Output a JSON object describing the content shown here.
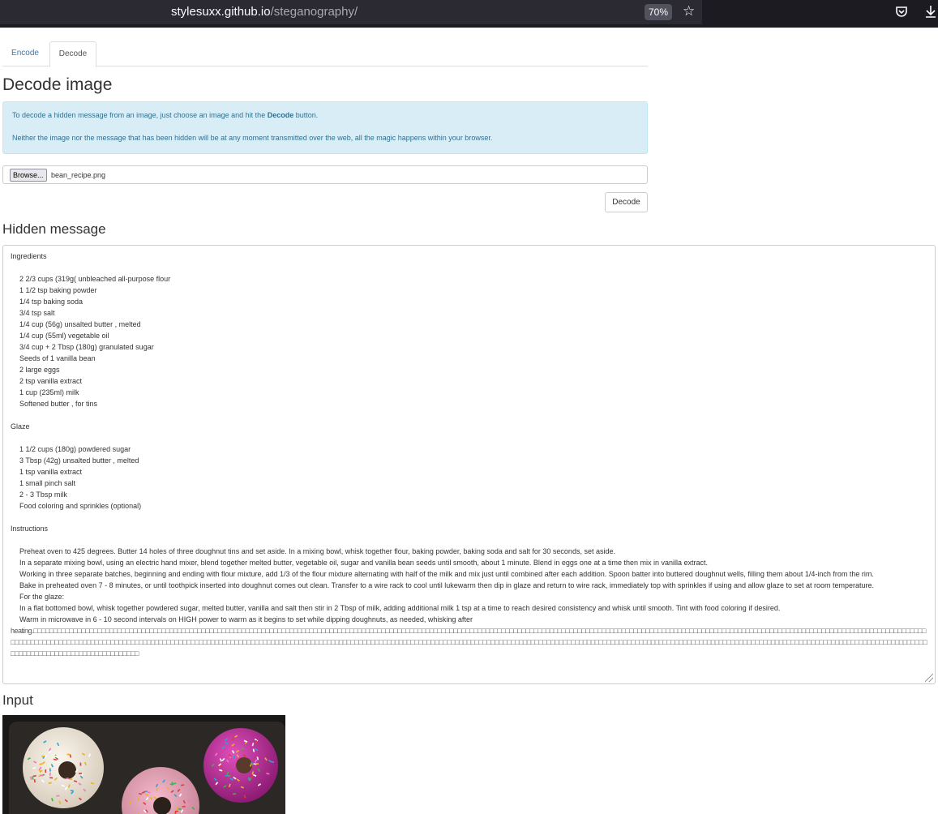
{
  "browser": {
    "url_host": "stylesuxx.github.io",
    "url_path": "/steganography/",
    "zoom": "70%",
    "bookmark_icon": "star-icon",
    "pocket_icon": "pocket-icon",
    "download_icon": "download-icon"
  },
  "tabs": {
    "encode": "Encode",
    "decode": "Decode",
    "active": "Decode"
  },
  "page_title": "Decode image",
  "alert": {
    "line1_before": "To decode a hidden message from an image, just choose an image and hit the ",
    "line1_bold": "Decode",
    "line1_after": " button.",
    "line2": "Neither the image nor the message that has been hidden will be at any moment transmitted over the web, all the magic happens within your browser."
  },
  "file_input": {
    "button": "Browse...",
    "filename": "bean_recipe.png"
  },
  "decode_button": "Decode",
  "hidden_heading": "Hidden message",
  "message": {
    "ingredients_title": "Ingredients",
    "ingredients": [
      "2 2/3 cups (319g( unbleached all-purpose flour",
      "1 1/2 tsp baking powder",
      "1/4 tsp baking soda",
      "3/4 tsp salt",
      "1/4 cup (56g) unsalted butter , melted",
      "1/4 cup (55ml) vegetable oil",
      "3/4 cup + 2 Tbsp (180g) granulated sugar",
      "Seeds of 1 vanilla bean",
      "2 large eggs",
      "2 tsp vanilla extract",
      "1 cup (235ml) milk",
      "Softened butter , for tins"
    ],
    "glaze_title": "Glaze",
    "glaze": [
      "1 1/2 cups (180g) powdered sugar",
      "3 Tbsp (42g) unsalted butter , melted",
      "1 tsp vanilla extract",
      "1 small pinch salt",
      "2 - 3 Tbsp milk",
      "Food coloring and sprinkles (optional)"
    ],
    "instructions_title": "Instructions",
    "instructions": [
      "Preheat oven to 425 degrees. Butter 14 holes of three doughnut tins and set aside. In a mixing bowl, whisk together flour, baking powder, baking soda and salt for 30 seconds, set aside.",
      "In a separate mixing bowl, using an electric hand mixer, blend together melted butter, vegetable oil, sugar and vanilla bean seeds until smooth, about 1 minute. Blend in eggs one at a time then mix in vanilla extract.",
      "Working in three separate batches, beginning and ending with flour mixture, add 1/3 of the flour mixture alternating with half of the milk and mix just until combined after each addition. Spoon batter into buttered doughnut wells, filling them about 1/4-inch from the rim.",
      "Bake in preheated oven 7 - 8 minutes, or until toothpick inserted into doughnut comes out clean. Transfer to a wire rack to cool until lukewarm then dip in glaze and return to wire rack, immediately top with sprinkles if using and allow glaze to set at room temperature.",
      "For the glaze:",
      "In a flat bottomed bowl, whisk together powdered sugar, melted butter, vanilla and salt then stir in 2 Tbsp of milk, adding additional milk 1 tsp at a time to reach desired consistency and whisk until smooth. Tint with food coloring if desired.",
      "Warm in microwave in 6 - 10 second intervals on HIGH power to warm as it begins to set while dipping doughnuts, as needed, whisking after"
    ],
    "trailing_word": "heating.",
    "trailing_glyphs": "□□□□□□□□□□□□□□□□□□□□□□□□□□□□□□□□□□□□□□□□□□□□□□□□□□□□□□□□□□□□□□□□□□□□□□□□□□□□□□□□□□□□□□□□□□□□□□□□□□□□□□□□□□□□□□□□□□□□□□□□□□□□□□□□□□□□□□□□□□□□□□□□□□□□□□□□□□□□□□□□□□□□□□□□□□□□□□□□□□□□□□□□□□□□□□□□□□□□□□□□□□□□□□□□□□□□□□□□□□□□□□□□□□□□□□□□□□□□□□□□□□□□□□□□□□□□□□□□□□□□□□□□□□□□□□□□□□□□□□□□□□□□□□□□□□□□□□□□□□□□□□□□□□□□□□□□□□□□□□□□□□□□□□□□□□□□□□□□□□□□□□□□□□□□□□□□□□□□□□□□□□□□□□□□□□□□□□□□□□□□□□□□□□□□□□□□□□□□□□□□□□□□□□□□□□□□□□□□□□□□□□□□□□□□□□□□□□□□□□□□□□□□□□□□□□□□□□□□□□□□□□□□□□□□□□□□□□□□□□□□□□□□"
  },
  "input_heading": "Input"
}
